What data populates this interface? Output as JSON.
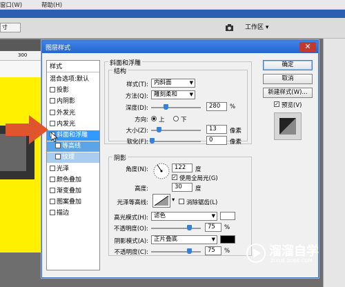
{
  "app": {
    "menu": [
      "窗口(W)",
      "帮助(H)"
    ],
    "options_bar": {
      "size_field": "寸",
      "workspace_label": "工作区"
    },
    "ruler_label": "300"
  },
  "dialog": {
    "title": "图层样式",
    "close_symbol": "✕",
    "styles": [
      {
        "label": "样式",
        "checkbox": false,
        "state": "header"
      },
      {
        "label": "混合选项:默认",
        "checkbox": false,
        "state": "normal"
      },
      {
        "label": "投影",
        "checkbox": true,
        "state": "normal"
      },
      {
        "label": "内阴影",
        "checkbox": true,
        "state": "normal"
      },
      {
        "label": "外发光",
        "checkbox": true,
        "state": "normal"
      },
      {
        "label": "内发光",
        "checkbox": true,
        "state": "normal"
      },
      {
        "label": "斜面和浮雕",
        "checkbox": true,
        "state": "selected"
      },
      {
        "label": "等高线",
        "checkbox": true,
        "state": "sub"
      },
      {
        "label": "纹理",
        "checkbox": true,
        "state": "sub2"
      },
      {
        "label": "光泽",
        "checkbox": true,
        "state": "normal"
      },
      {
        "label": "颜色叠加",
        "checkbox": true,
        "state": "normal"
      },
      {
        "label": "渐变叠加",
        "checkbox": true,
        "state": "normal"
      },
      {
        "label": "图案叠加",
        "checkbox": true,
        "state": "normal"
      },
      {
        "label": "描边",
        "checkbox": true,
        "state": "normal"
      }
    ],
    "bevel": {
      "section_title": "斜面和浮雕",
      "structure_title": "结构",
      "style_label": "样式(T):",
      "style_value": "内斜面",
      "method_label": "方法(Q):",
      "method_value": "雕刻柔和",
      "depth_label": "深度(D):",
      "depth_value": "280",
      "depth_unit": "%",
      "direction_label": "方向:",
      "direction_up": "上",
      "direction_down": "下",
      "size_label": "大小(Z):",
      "size_value": "13",
      "size_unit": "像素",
      "soften_label": "软化(F):",
      "soften_value": "0",
      "soften_unit": "像素"
    },
    "shading": {
      "title": "阴影",
      "angle_label": "角度(N):",
      "angle_value": "122",
      "angle_unit": "度",
      "global_light_label": "使用全局光(G)",
      "altitude_label": "高度:",
      "altitude_value": "30",
      "altitude_unit": "度",
      "gloss_contour_label": "光泽等高线:",
      "anti_alias_label": "消除锯齿(L)",
      "highlight_mode_label": "高光模式(H):",
      "highlight_mode_value": "滤色",
      "highlight_opacity_label": "不透明度(O):",
      "highlight_opacity_value": "75",
      "highlight_opacity_unit": "%",
      "shadow_mode_label": "阴影模式(A):",
      "shadow_mode_value": "正片叠底",
      "shadow_opacity_label": "不透明度(C):",
      "shadow_opacity_value": "75",
      "shadow_opacity_unit": "%"
    },
    "buttons": {
      "ok": "确定",
      "cancel": "取消",
      "new_style": "新建样式(W)...",
      "preview": "预览(V)"
    }
  },
  "watermark": {
    "brand": "溜溜自学",
    "url": "ZIXUE.3D66.COM"
  },
  "colors": {
    "accent": "#3399ff",
    "highlight_color": "#ffffff",
    "shadow_color": "#000000",
    "arrow": "#e0542e"
  }
}
